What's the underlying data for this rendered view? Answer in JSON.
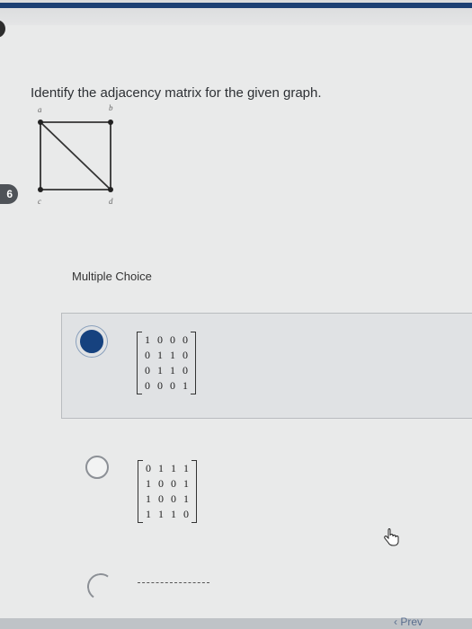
{
  "question": {
    "number": "6",
    "text": "Identify the adjacency matrix for the given graph."
  },
  "graph": {
    "vertices": [
      {
        "label": "a"
      },
      {
        "label": "b"
      },
      {
        "label": "c"
      },
      {
        "label": "d"
      }
    ],
    "edges": [
      [
        "a",
        "b"
      ],
      [
        "a",
        "c"
      ],
      [
        "a",
        "d"
      ],
      [
        "b",
        "d"
      ],
      [
        "c",
        "d"
      ]
    ]
  },
  "multiple_choice_label": "Multiple Choice",
  "options": [
    {
      "selected": true,
      "matrix": [
        [
          "1",
          "0",
          "0",
          "0"
        ],
        [
          "0",
          "1",
          "1",
          "0"
        ],
        [
          "0",
          "1",
          "1",
          "0"
        ],
        [
          "0",
          "0",
          "0",
          "1"
        ]
      ]
    },
    {
      "selected": false,
      "matrix": [
        [
          "0",
          "1",
          "1",
          "1"
        ],
        [
          "1",
          "0",
          "0",
          "1"
        ],
        [
          "1",
          "0",
          "0",
          "1"
        ],
        [
          "1",
          "1",
          "1",
          "0"
        ]
      ]
    }
  ],
  "nav": {
    "prev_label": "Prev",
    "prev_icon": "chevron-left-icon"
  },
  "colors": {
    "selected_radio": "#16427f",
    "header_accent": "#1c3f73"
  }
}
